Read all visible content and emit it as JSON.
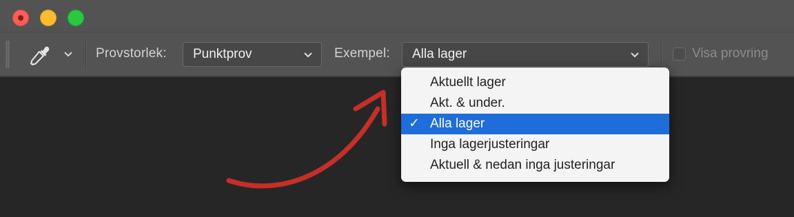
{
  "window": {
    "traffic_lights": [
      "close",
      "minimize",
      "zoom"
    ]
  },
  "toolbar": {
    "tool_icon": "eyedropper-icon",
    "sample_size": {
      "label": "Provstorlek:",
      "value": "Punktprov"
    },
    "sample": {
      "label": "Exempel:",
      "value": "Alla lager",
      "options": [
        "Aktuellt lager",
        "Akt. & under.",
        "Alla lager",
        "Inga lagerjusteringar",
        "Aktuell & nedan inga justeringar"
      ],
      "selected_index": 2,
      "check_mark": "✓"
    },
    "show_ring": {
      "label": "Visa provring",
      "checked": false
    }
  },
  "colors": {
    "selection": "#1f6dd9",
    "annotation_arrow": "#c62f28"
  }
}
